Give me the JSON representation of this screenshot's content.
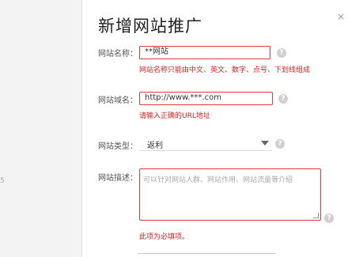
{
  "page": {
    "title": "新增网站推广",
    "left_fragment": "5",
    "close_fragment": "×"
  },
  "form": {
    "site_name": {
      "label": "网站名称：",
      "value": "**网站",
      "error": "网站名称只能由中文、英文、数字、点号、下划线组成"
    },
    "site_domain": {
      "label": "网站域名：",
      "value": "http://www.***.com",
      "error": "请输入正确的URL地址"
    },
    "site_type": {
      "label": "网站类型：",
      "selected": "返利"
    },
    "site_desc": {
      "label": "网站描述：",
      "placeholder": "可以针对网站人群、网站作用、网站流量等介绍",
      "error": "此项为必填项。"
    },
    "help_icon": "?"
  },
  "colors": {
    "error": "#e02020",
    "border_error": "#e33b3b",
    "help": "#d0d0d0"
  }
}
